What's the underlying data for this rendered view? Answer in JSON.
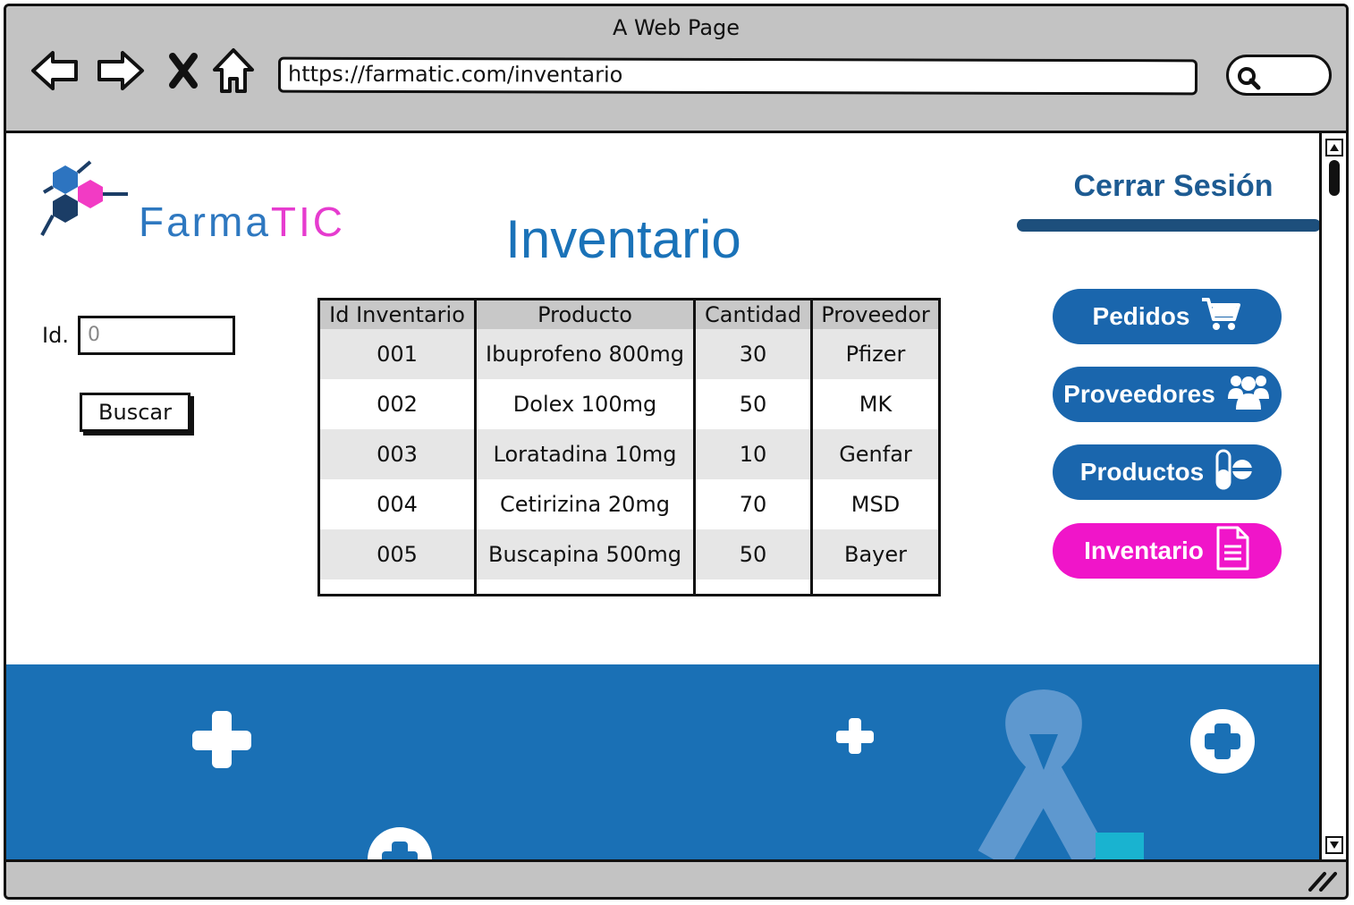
{
  "window": {
    "title": "A Web Page"
  },
  "browser": {
    "url": "https://farmatic.com/inventario"
  },
  "logo": {
    "part1": "Farma",
    "part2": "TIC"
  },
  "page": {
    "title": "Inventario",
    "logout": "Cerrar Sesión"
  },
  "search": {
    "label": "Id.",
    "placeholder": "0",
    "button": "Buscar"
  },
  "table": {
    "headers": [
      "Id Inventario",
      "Producto",
      "Cantidad",
      "Proveedor"
    ],
    "rows": [
      [
        "001",
        "Ibuprofeno 800mg",
        "30",
        "Pfizer"
      ],
      [
        "002",
        "Dolex 100mg",
        "50",
        "MK"
      ],
      [
        "003",
        "Loratadina 10mg",
        "10",
        "Genfar"
      ],
      [
        "004",
        "Cetirizina 20mg",
        "70",
        "MSD"
      ],
      [
        "005",
        "Buscapina 500mg",
        "50",
        "Bayer"
      ]
    ]
  },
  "nav": [
    {
      "label": "Pedidos",
      "icon": "cart-icon"
    },
    {
      "label": "Proveedores",
      "icon": "users-icon"
    },
    {
      "label": "Productos",
      "icon": "pill-icon"
    },
    {
      "label": "Inventario",
      "icon": "document-icon"
    }
  ],
  "colors": {
    "primary": "#1a66ad",
    "accent": "#f015c9",
    "banner": "#1a70b5",
    "title": "#1a72b8"
  }
}
